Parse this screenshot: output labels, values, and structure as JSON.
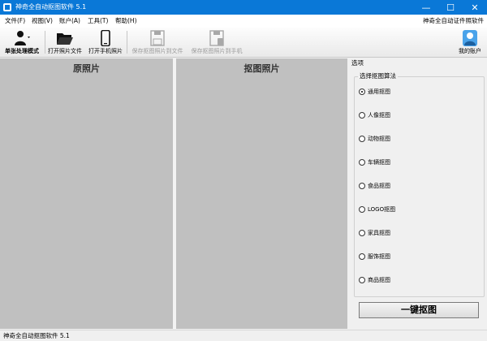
{
  "window": {
    "title": "神奇全自动抠图软件 5.1",
    "minimize": "—",
    "maximize": "☐",
    "close": "✕"
  },
  "menu": {
    "items": [
      "文件(F)",
      "视图(V)",
      "账户(A)",
      "工具(T)",
      "帮助(H)"
    ],
    "right_text": "神奇全自动证件照软件"
  },
  "toolbar": {
    "mode_label": "单张处理模式",
    "open_file": "打开照片文件",
    "open_phone": "打开手机照片",
    "save_file": "保存抠图照片到文件",
    "save_phone": "保存抠图照片到手机",
    "account": "我的账户"
  },
  "panels": {
    "original_title": "原照片",
    "result_title": "抠图照片"
  },
  "options": {
    "header": "选项",
    "group_label": "选择抠图算法",
    "radios": [
      "通用抠图",
      "人像抠图",
      "动物抠图",
      "车辆抠图",
      "食品抠图",
      "LOGO抠图",
      "家具抠图",
      "服饰抠图",
      "商品抠图"
    ],
    "selected_index": 0
  },
  "action_button": "一键抠图",
  "status": "神奇全自动抠图软件 5.1",
  "colors": {
    "titlebar": "#0a78d7",
    "panel_bg": "#c0c0c0"
  },
  "icons": {
    "mode": "person-icon",
    "open_file": "folder-icon",
    "open_phone": "phone-icon",
    "save_file": "floppy-icon",
    "save_phone": "floppy-phone-icon",
    "account": "user-avatar-icon"
  }
}
